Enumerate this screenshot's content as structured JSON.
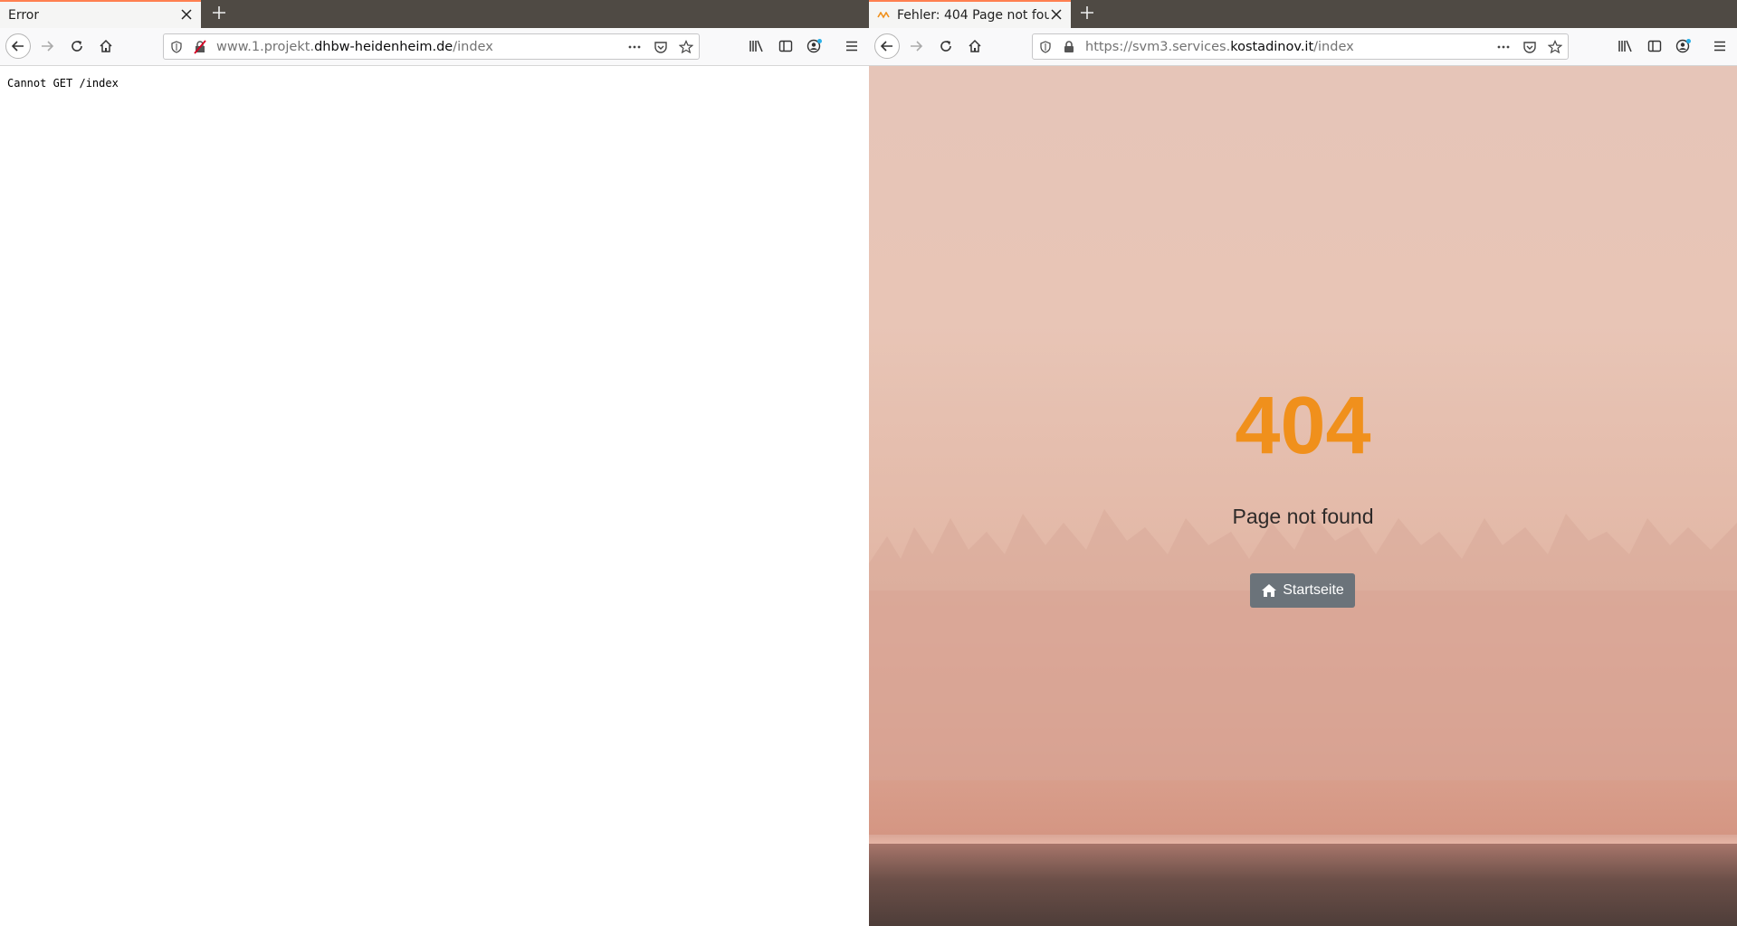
{
  "left_window": {
    "tab_title": "Error",
    "url_prefix": "www.1.projekt.",
    "url_domain": "dhbw-heidenheim.de",
    "url_path": "/index",
    "page_text": "Cannot GET /index"
  },
  "right_window": {
    "tab_title": "Fehler: 404 Page not fou",
    "url_prefix": "https://svm3.services.",
    "url_domain": "kostadinov.it",
    "url_path": "/index",
    "error_code": "404",
    "error_message": "Page not found",
    "home_button_label": "Startseite"
  },
  "icons": [
    "close-icon",
    "plus-icon",
    "back-arrow-icon",
    "forward-arrow-icon",
    "reload-icon",
    "home-icon",
    "tracking-shield-icon",
    "insecure-lock-icon",
    "lock-icon",
    "more-icon",
    "pocket-icon",
    "bookmark-star-icon",
    "library-icon",
    "sidebar-icon",
    "account-icon",
    "hamburger-menu-icon"
  ],
  "colors": {
    "accent_orange": "#f0901c",
    "button_gray": "#6b737a",
    "tabbar": "#4f4a44"
  }
}
